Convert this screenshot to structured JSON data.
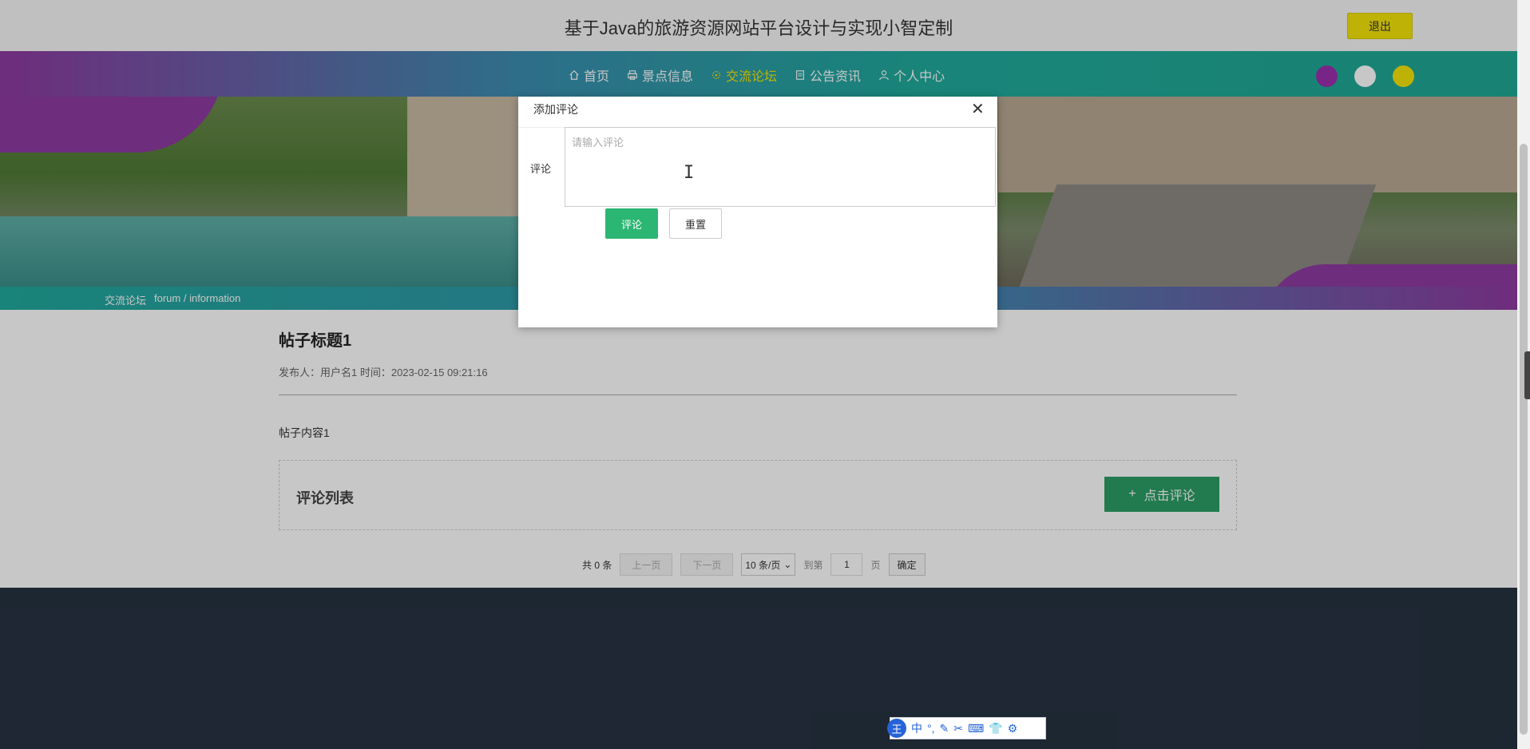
{
  "header": {
    "title": "基于Java的旅游资源网站平台设计与实现小智定制",
    "logout_label": "退出"
  },
  "nav": {
    "items": [
      {
        "label": "首页",
        "icon": "home-icon",
        "active": false
      },
      {
        "label": "景点信息",
        "icon": "printer-icon",
        "active": false
      },
      {
        "label": "交流论坛",
        "icon": "forum-icon",
        "active": true
      },
      {
        "label": "公告资讯",
        "icon": "document-icon",
        "active": false
      },
      {
        "label": "个人中心",
        "icon": "user-icon",
        "active": false
      }
    ],
    "active_color": "#f5e50a"
  },
  "theme_colors": [
    "#9b2fae",
    "#ffffff",
    "#f5e50a"
  ],
  "breadcrumb": {
    "section": "交流论坛",
    "path": "forum / information"
  },
  "post": {
    "title": "帖子标题1",
    "meta": "发布人：用户名1 时间：2023-02-15 09:21:16",
    "body": "帖子内容1"
  },
  "comments": {
    "heading": "评论列表",
    "add_label": "点击评论",
    "add_color": "#2b9e64"
  },
  "pager": {
    "total": "共 0 条",
    "prev": "上一页",
    "next": "下一页",
    "per_page": "10 条/页",
    "goto": "到第",
    "page": "1",
    "page_unit": "页",
    "confirm": "确定"
  },
  "modal": {
    "title": "添加评论",
    "field_label": "评论",
    "placeholder": "请输入评论",
    "submit_label": "评论",
    "reset_label": "重置",
    "submit_color": "#2bb673"
  },
  "ime": {
    "logo": "王",
    "mode": "中"
  }
}
